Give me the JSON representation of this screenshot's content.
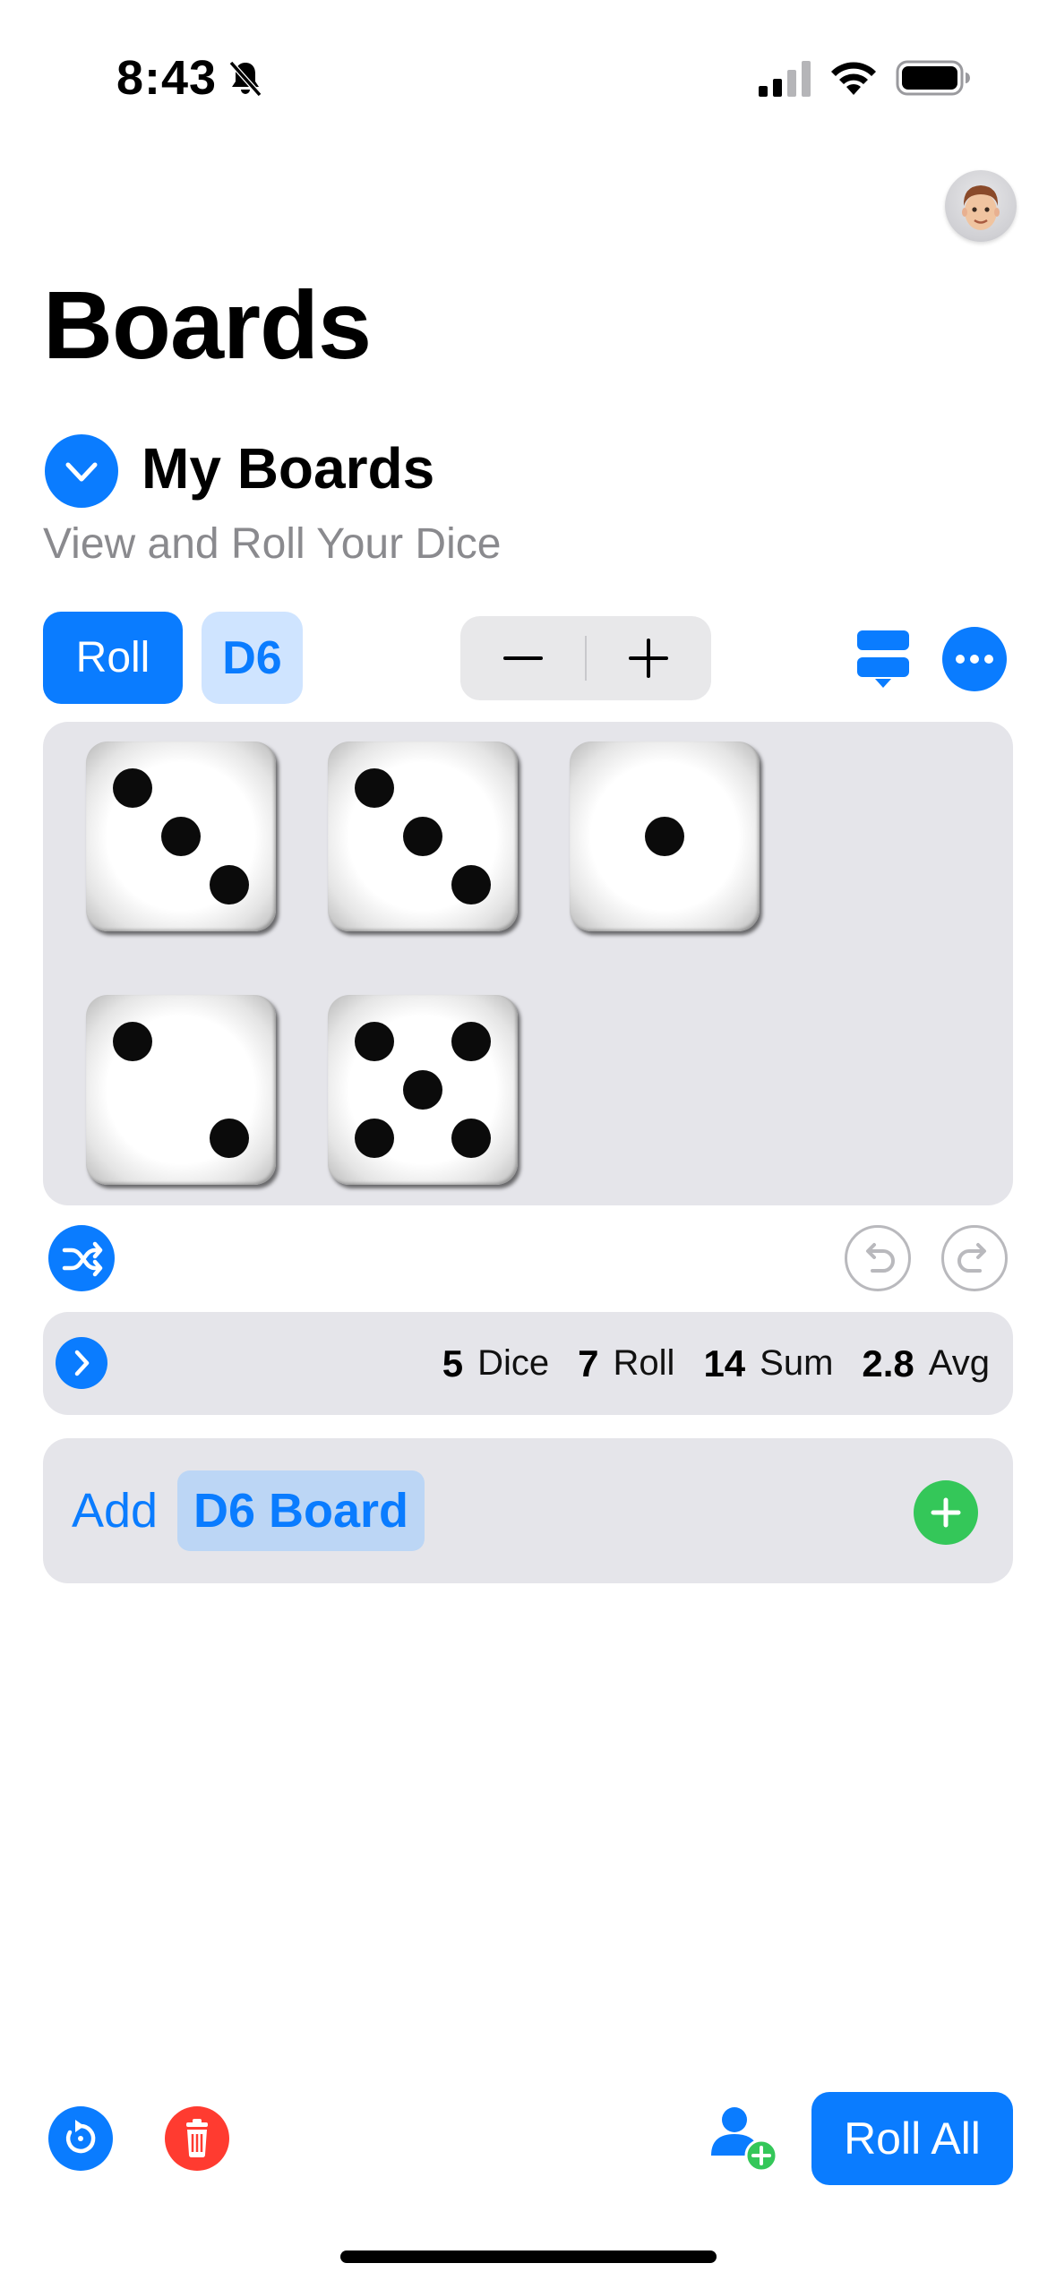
{
  "status_bar": {
    "time": "8:43"
  },
  "page": {
    "title": "Boards"
  },
  "section": {
    "title": "My Boards",
    "subtitle": "View and Roll Your Dice"
  },
  "toolbar": {
    "roll_label": "Roll",
    "die_type": "D6",
    "stepper_minus": "−",
    "stepper_plus": "+"
  },
  "board": {
    "dice": [
      3,
      3,
      1,
      2,
      5
    ]
  },
  "stats": {
    "dice_count": "5",
    "dice_label": "Dice",
    "roll_count": "7",
    "roll_label": "Roll",
    "sum": "14",
    "sum_label": "Sum",
    "avg": "2.8",
    "avg_label": "Avg"
  },
  "add_board": {
    "label": "Add",
    "type": "D6 Board"
  },
  "bottom_bar": {
    "roll_all_label": "Roll All"
  },
  "colors": {
    "accent": "#0a7cff",
    "green": "#34c759",
    "red": "#ff3b30",
    "panel": "#e5e5ea"
  },
  "icons": [
    "bell-slash-icon",
    "signal-icon",
    "wifi-icon",
    "battery-icon",
    "chevron-down-icon",
    "layout-split-icon",
    "more-icon",
    "shuffle-icon",
    "undo-icon",
    "redo-icon",
    "chevron-right-icon",
    "plus-icon",
    "reset-icon",
    "trash-icon",
    "add-person-icon"
  ]
}
